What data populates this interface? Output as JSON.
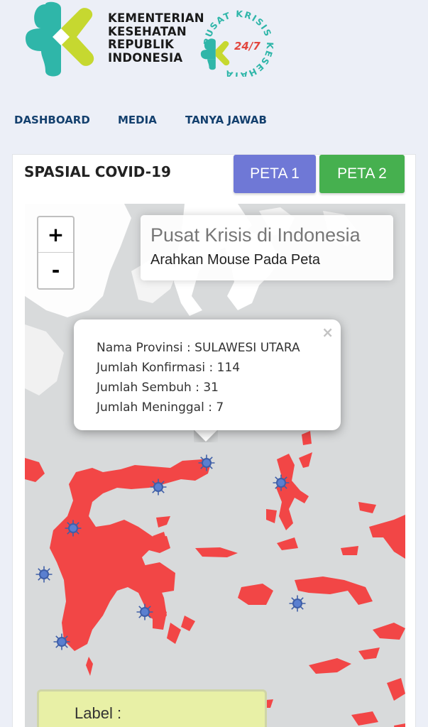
{
  "header": {
    "ministry_lines": [
      "KEMENTERIAN",
      "KESEHATAN",
      "REPUBLIK",
      "INDONESIA"
    ],
    "crisis_logo": {
      "arc_text": "PUSAT KRISIS KESEHATAN",
      "badge": "24/7"
    }
  },
  "nav": {
    "items": [
      {
        "label": "DASHBOARD"
      },
      {
        "label": "MEDIA"
      },
      {
        "label": "TANYA JAWAB"
      }
    ]
  },
  "card": {
    "title": "SPASIAL COVID-19",
    "buttons": {
      "peta1": "PETA 1",
      "peta2": "PETA 2"
    }
  },
  "map": {
    "zoom_in": "+",
    "zoom_out": "-",
    "info": {
      "title": "Pusat Krisis di Indonesia",
      "subtitle": "Arahkan Mouse Pada Peta"
    },
    "popup": {
      "close": "×",
      "lines": [
        "Nama Provinsi : SULAWESI UTARA",
        "Jumlah Konfirmasi : 114",
        "Jumlah Sembuh : 31",
        "Jumlah Meninggal : 7"
      ]
    },
    "legend_label": "Label :",
    "colors": {
      "land": "#ffffff",
      "sea": "#d8dadb",
      "highlight": "#f24646",
      "virus": "#3f5fa8"
    },
    "marker_icon": "coronavirus-icon"
  }
}
